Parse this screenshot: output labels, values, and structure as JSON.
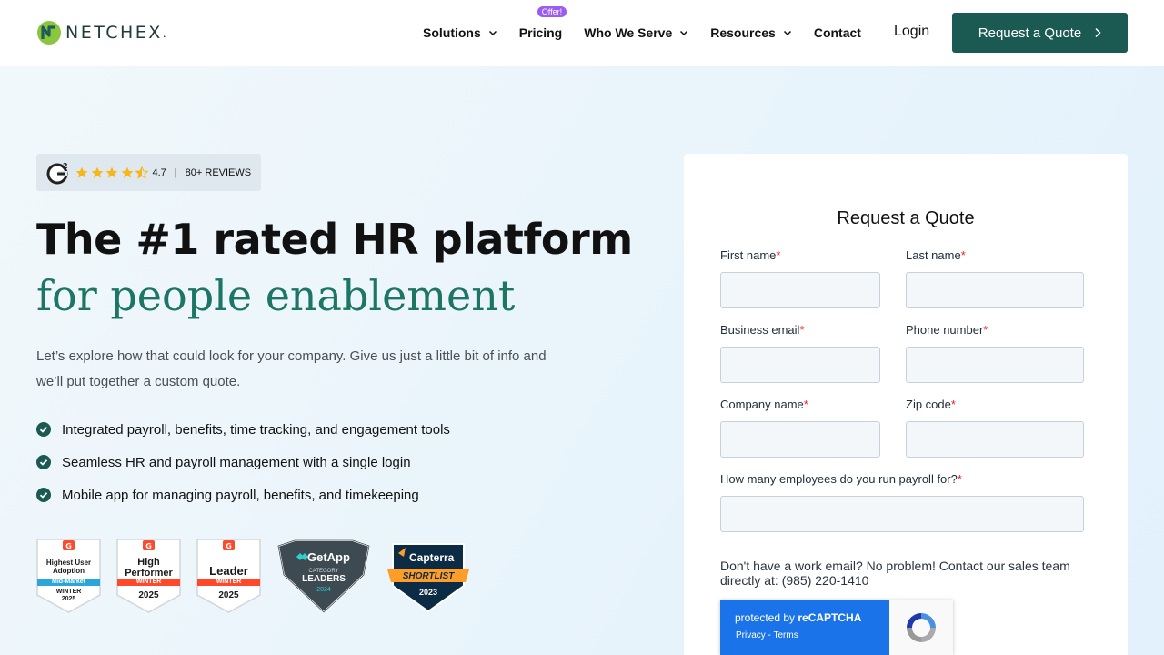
{
  "header": {
    "logo_text": "NETCHEX",
    "nav": [
      {
        "label": "Solutions"
      },
      {
        "label": "Pricing",
        "badge": "Offer!"
      },
      {
        "label": "Who We Serve"
      },
      {
        "label": "Resources"
      },
      {
        "label": "Contact"
      }
    ],
    "login_label": "Login",
    "quote_button_label": "Request a Quote"
  },
  "hero": {
    "rating": {
      "value": "4.7",
      "separator": "|",
      "reviews": "80+ REVIEWS",
      "stars": 4.5
    },
    "headline_dark": "The #1 rated HR platform ",
    "headline_green": "for people enablement",
    "subtext": "Let’s explore how that could look for your company. Give us just a little bit of info and we’ll put together a custom quote.",
    "bullets": [
      "Integrated payroll, benefits, time tracking, and engagement tools",
      "Seamless HR and payroll management with a single login",
      "Mobile app for managing payroll, benefits, and timekeeping"
    ],
    "badges": {
      "b1": {
        "title": "Highest User Adoption",
        "strip": "Mid-Market",
        "season": "WINTER",
        "year": "2025"
      },
      "b2": {
        "title": "High Performer",
        "strip": "WINTER",
        "year": "2025"
      },
      "b3": {
        "title": "Leader",
        "strip": "WINTER",
        "year": "2025"
      },
      "getapp": {
        "brand": "GetApp",
        "line1": "CATEGORY",
        "line2": "LEADERS",
        "year": "2024"
      },
      "capterra": {
        "brand": "Capterra",
        "ribbon": "SHORTLIST",
        "year": "2023"
      }
    }
  },
  "form": {
    "title": "Request a Quote",
    "required_mark": "*",
    "fields": {
      "first_name": "First name",
      "last_name": "Last name",
      "email": "Business email",
      "phone": "Phone number",
      "company": "Company name",
      "zip": "Zip code",
      "employees": "How many employees do you run payroll for?"
    },
    "note": "Don't have a work email? No problem! Contact our sales team directly at: (985) 220-1410"
  },
  "recaptcha": {
    "protected_by": "protected by ",
    "brand": "reCAPTCHA",
    "links": "Privacy - Terms"
  },
  "colors": {
    "primary": "#1b5a52",
    "accent_green": "#1d7565",
    "offer_purple": "#9b5cf0",
    "star": "#f5b719",
    "required": "#e1242a"
  }
}
